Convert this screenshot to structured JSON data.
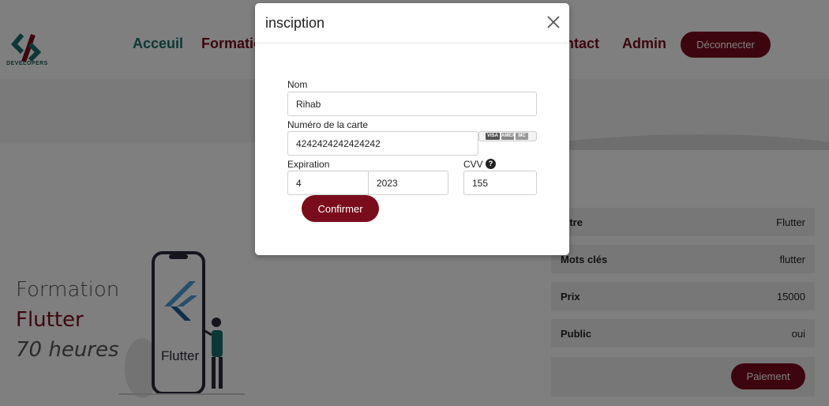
{
  "brand": {
    "logo_text": "DEVELOPERS"
  },
  "nav": {
    "items": [
      {
        "label": "Acceuil"
      },
      {
        "label": "Formation"
      },
      {
        "label": "Contact"
      },
      {
        "label": "Admin"
      }
    ],
    "logout_label": "Déconnecter"
  },
  "hero": {
    "title": "Formation",
    "name": "Flutter",
    "hours": "70 heures",
    "illustration_text": "Flutter"
  },
  "details": {
    "rows": [
      {
        "label": "Titre",
        "value": "Flutter"
      },
      {
        "label": "Mots clés",
        "value": "flutter"
      },
      {
        "label": "Prix",
        "value": "15000"
      },
      {
        "label": "Public",
        "value": "oui"
      }
    ],
    "pay_label": "Paiement"
  },
  "modal": {
    "title": "insciption",
    "name_label": "Nom",
    "name_value": "Rihab",
    "card_label": "Numéro de la carte",
    "card_value": "4242424242424242",
    "card_brands": [
      "VISA",
      "AMEX",
      "MC"
    ],
    "expiration_label": "Expiration",
    "exp_month": "4",
    "exp_year": "2023",
    "cvv_label": "CVV",
    "cvv_value": "155",
    "confirm_label": "Confirmer"
  },
  "colors": {
    "brand_red": "#7a0d1c",
    "brand_teal": "#1b6f6f"
  }
}
